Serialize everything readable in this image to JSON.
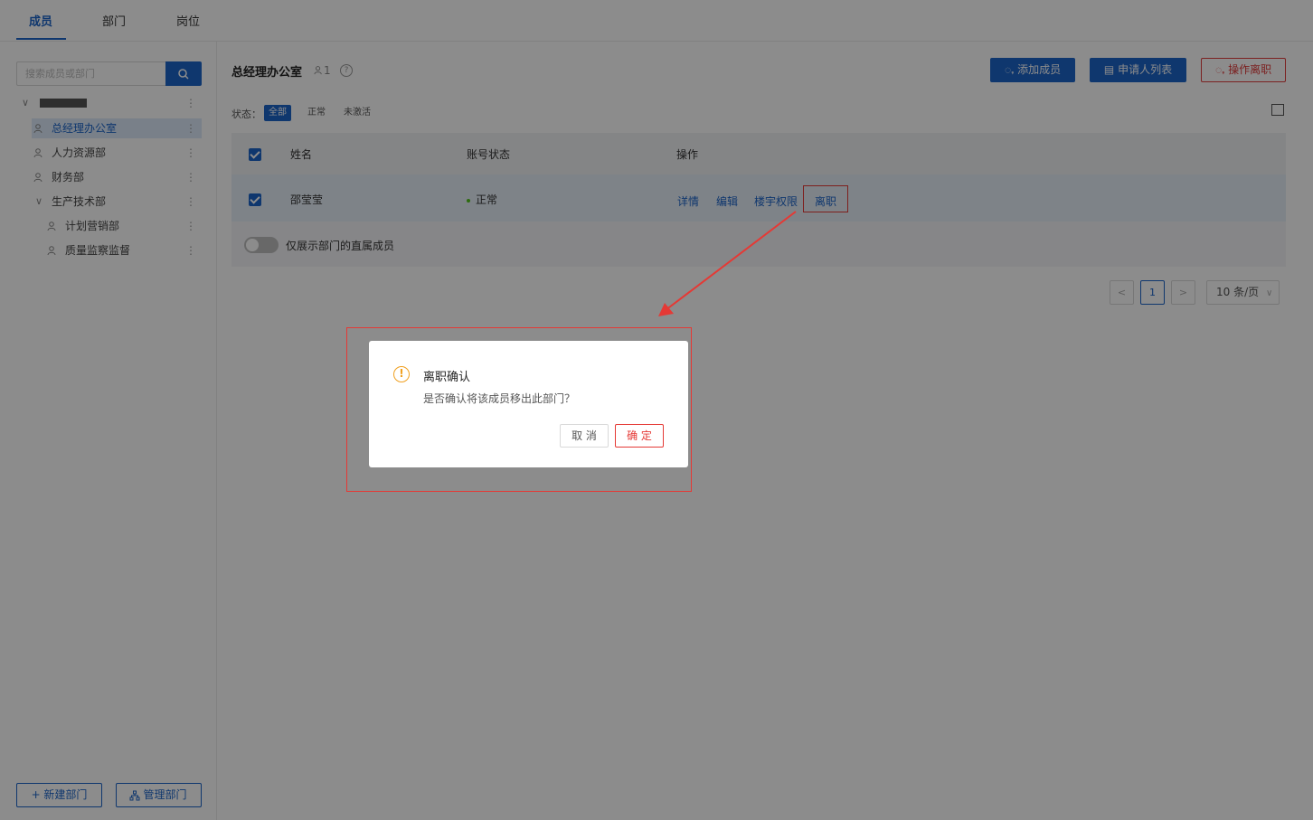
{
  "tabs": [
    {
      "label": "成员",
      "active": true
    },
    {
      "label": "部门"
    },
    {
      "label": "岗位"
    }
  ],
  "sidebar": {
    "search_placeholder": "搜索成员或部门",
    "tree": [
      {
        "label": "总经理办公室",
        "selected": true
      },
      {
        "label": "人力资源部"
      },
      {
        "label": "财务部"
      },
      {
        "label": "生产技术部"
      },
      {
        "label": "计划营销部"
      },
      {
        "label": "质量监察监督"
      }
    ],
    "new_dept_label": "+ 新建部门",
    "manage_dept_label": "管理部门"
  },
  "main": {
    "dept_title": "总经理办公室",
    "dept_count": "1",
    "buttons": {
      "add_member": "添加成员",
      "applicant_list": "申请人列表",
      "operate_resign": "操作离职"
    },
    "status_label": "状态：",
    "status_options": [
      "全部",
      "正常",
      "未激活"
    ],
    "table": {
      "headers": [
        "姓名",
        "账号状态",
        "操作"
      ],
      "rows": [
        {
          "name": "邵莹莹",
          "status": "正常",
          "ops": [
            "详情",
            "编辑",
            "楼宇权限",
            "离职"
          ]
        }
      ],
      "direct_only_label": "仅展示部门的直属成员"
    },
    "pagination": {
      "current": "1",
      "prev": "<",
      "next": ">",
      "page_size": "10 条/页"
    }
  },
  "dialog": {
    "title": "离职确认",
    "message": "是否确认将该成员移出此部门？",
    "cancel": "取 消",
    "ok": "确 定"
  },
  "colors": {
    "primary": "#1c64c8",
    "danger": "#e53935",
    "warning": "#f0a020",
    "success": "#52c41a"
  },
  "icons": [
    "search-icon",
    "person-icon",
    "help-icon",
    "column-setting-icon",
    "warning-icon",
    "org-icon"
  ]
}
